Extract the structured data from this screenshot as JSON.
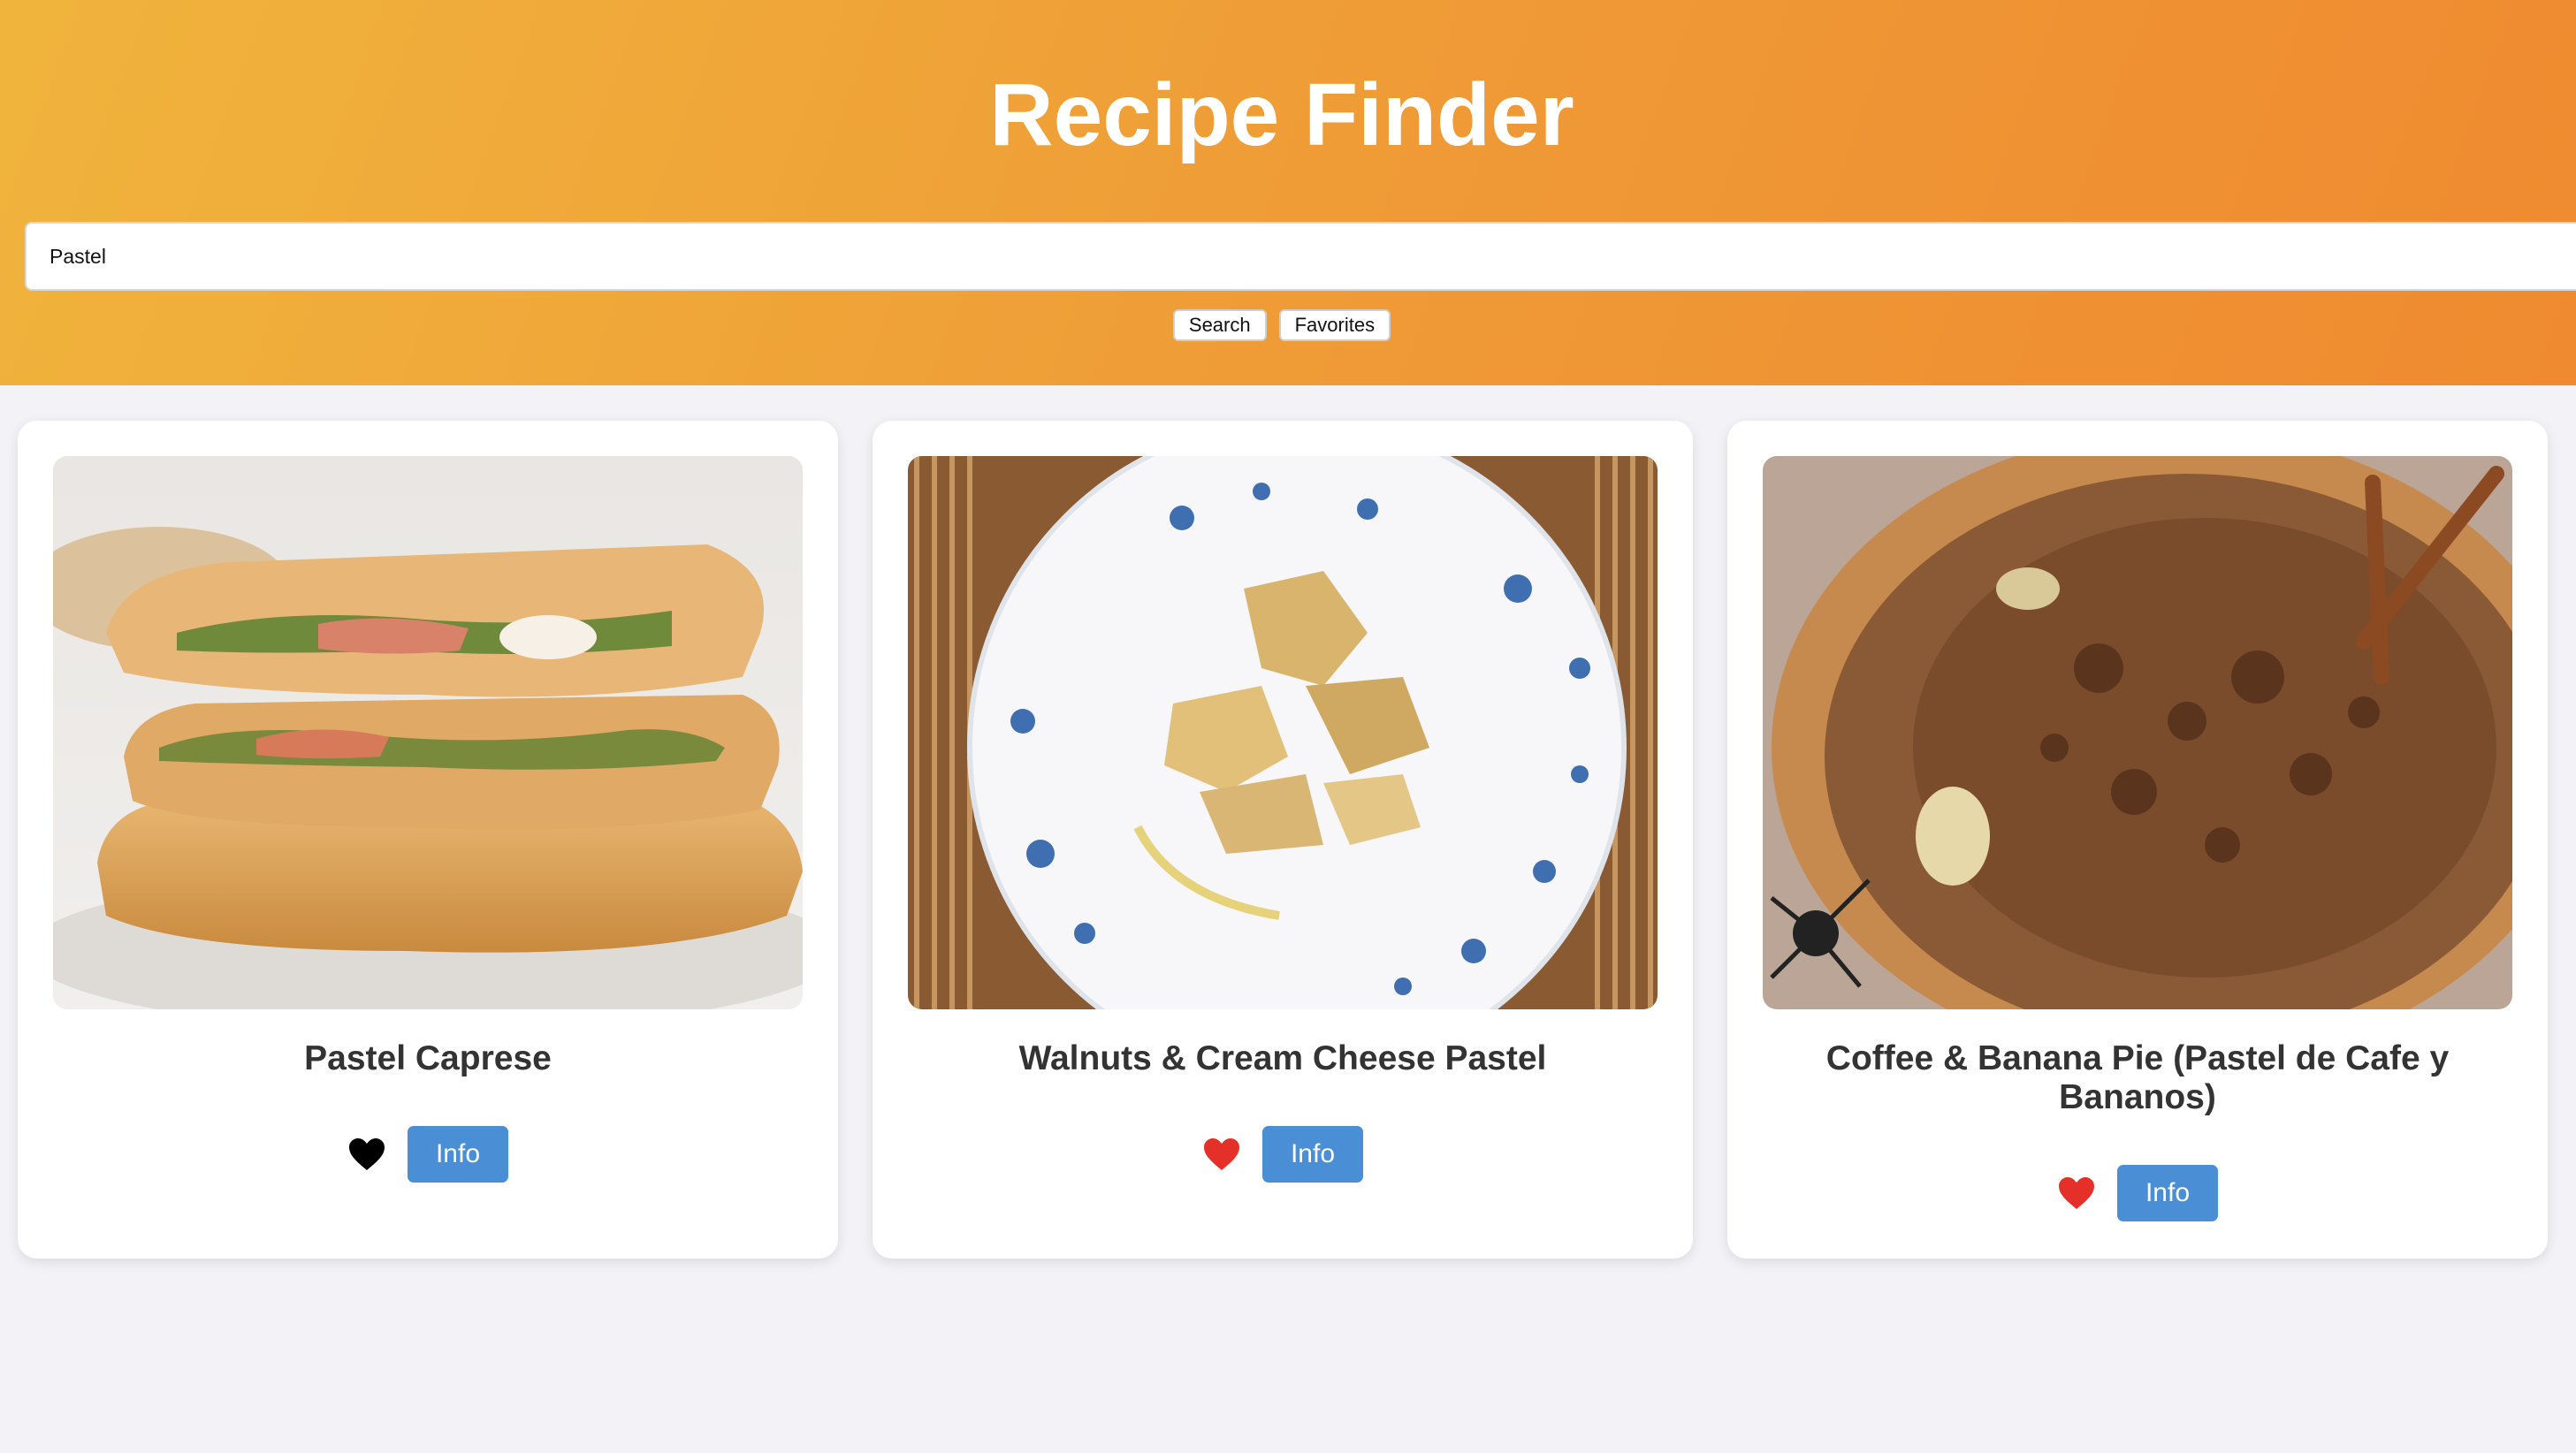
{
  "app": {
    "title": "Recipe Finder"
  },
  "search": {
    "value": "Pastel",
    "placeholder": ""
  },
  "buttons": {
    "search_label": "Search",
    "favorites_label": "Favorites"
  },
  "colors": {
    "header_gradient_start": "#f0b43c",
    "header_gradient_end": "#ef8a30",
    "info_button": "#4a8fd6",
    "heart_favorited": "#e5302a",
    "heart_default": "#000000",
    "page_background": "#f3f3f7"
  },
  "recipes": [
    {
      "title": "Pastel Caprese",
      "image_icon": "fried-pastry-photo",
      "favorited": false,
      "info_label": "Info"
    },
    {
      "title": "Walnuts & Cream Cheese Pastel",
      "image_icon": "plate-pastries-photo",
      "favorited": true,
      "info_label": "Info"
    },
    {
      "title": "Coffee & Banana Pie (Pastel de Cafe y Bananos)",
      "image_icon": "banana-pie-photo",
      "favorited": true,
      "info_label": "Info"
    }
  ]
}
